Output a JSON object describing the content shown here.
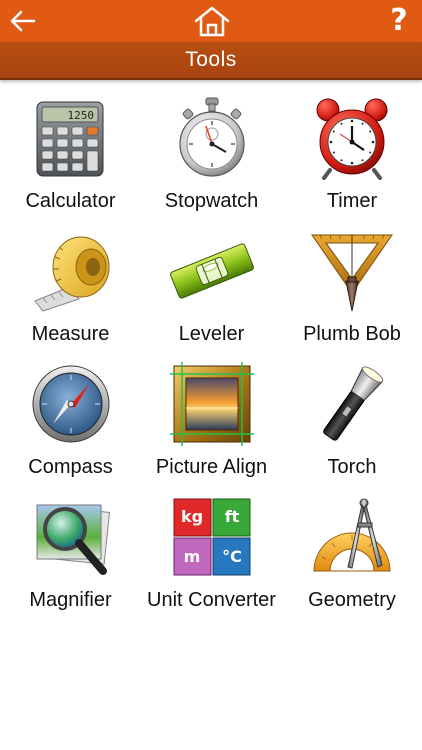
{
  "header": {
    "back_icon": "arrow-left-icon",
    "home_icon": "home-icon",
    "help_label": "?",
    "bar_color": "#e05a14"
  },
  "title_bar": {
    "title": "Tools",
    "color": "#b84e12"
  },
  "tools": [
    {
      "label": "Calculator",
      "icon": "calculator-icon",
      "display": "1250"
    },
    {
      "label": "Stopwatch",
      "icon": "stopwatch-icon"
    },
    {
      "label": "Timer",
      "icon": "alarm-clock-icon"
    },
    {
      "label": "Measure",
      "icon": "measuring-tape-icon"
    },
    {
      "label": "Leveler",
      "icon": "spirit-level-icon"
    },
    {
      "label": "Plumb Bob",
      "icon": "plumb-bob-icon"
    },
    {
      "label": "Compass",
      "icon": "compass-icon"
    },
    {
      "label": "Picture Align",
      "icon": "picture-frame-icon"
    },
    {
      "label": "Torch",
      "icon": "flashlight-icon"
    },
    {
      "label": "Magnifier",
      "icon": "magnifier-icon"
    },
    {
      "label": "Unit Converter",
      "icon": "unit-converter-icon",
      "tiles": [
        "kg",
        "ft",
        "m",
        "°C"
      ]
    },
    {
      "label": "Geometry",
      "icon": "geometry-icon"
    }
  ]
}
